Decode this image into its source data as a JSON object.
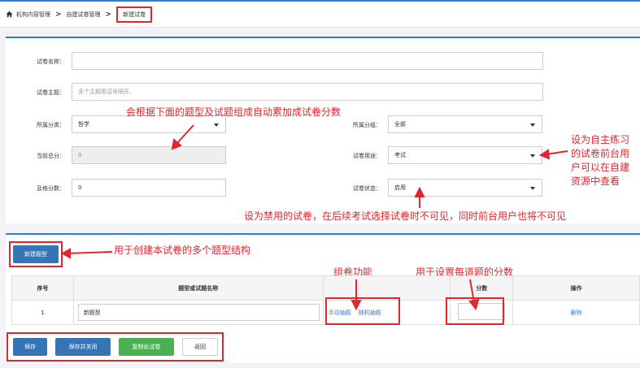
{
  "breadcrumb": {
    "items": [
      "机构内容管理",
      "自建试卷管理",
      "新建试卷"
    ]
  },
  "form": {
    "name_label": "试卷名称：",
    "name_value": "",
    "subject_label": "试卷主题：",
    "subject_placeholder": "多个主题用逗号隔开。",
    "category_label": "所属分类：",
    "category_value": "哲学",
    "group_label": "所属分组：",
    "group_value": "全部",
    "total_label": "当前总分：",
    "total_value": "0",
    "usage_label": "试卷用途：",
    "usage_value": "考试",
    "pass_label": "及格分数：",
    "pass_value": "0",
    "status_label": "试卷状态：",
    "status_value": "启用"
  },
  "annotations": {
    "total_score": "会根据下面的题型及试题组成自动累加成试卷分数",
    "usage": [
      "设为自主练习",
      "的试卷前台用",
      "户可以在自建",
      "资源中查看"
    ],
    "status": "设为禁用的试卷，在后续考试选择试卷时不可见，同时前台用户也将不可见",
    "new_type": "用于创建本试卷的多个题型结构",
    "compose": "组卷功能",
    "score": "用于设置每道题的分数"
  },
  "new_type_button": "新建题型",
  "table": {
    "headers": [
      "序号",
      "题型或试题名称",
      "",
      "分数",
      "操作"
    ],
    "rows": [
      {
        "index": "1",
        "name": "新题型",
        "manual": "手动抽题",
        "random": "随机抽题",
        "score": "",
        "action": "删除"
      }
    ]
  },
  "footer_buttons": {
    "save": "保存",
    "save_close": "保存并关闭",
    "copy": "复制此试卷",
    "back": "返回"
  },
  "colors": {
    "accent": "#2f7cd8",
    "annotation": "#e3262e",
    "button_blue": "#3574b5",
    "button_green": "#4caf50"
  }
}
